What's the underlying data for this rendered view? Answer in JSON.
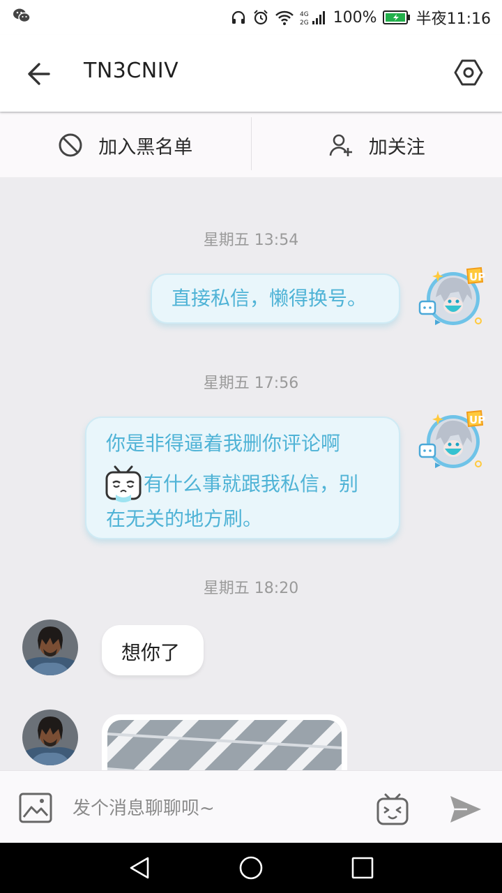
{
  "status_bar": {
    "battery_percent": "100%",
    "time": "半夜11:16",
    "network_label_top": "4G",
    "network_label_bottom": "2G",
    "icons": [
      "wechat-icon",
      "headphone-icon",
      "alarm-icon",
      "wifi-icon",
      "signal-icon",
      "battery-icon"
    ]
  },
  "header": {
    "title": "TN3CNIV",
    "back_icon": "arrow-left-icon",
    "settings_icon": "hexagon-settings-icon"
  },
  "actions": {
    "block_label": "加入黑名单",
    "follow_label": "加关注"
  },
  "messages": [
    {
      "timestamp": "星期五 13:54",
      "sender": "me",
      "text": "直接私信，懒得换号。"
    },
    {
      "timestamp": "星期五 17:56",
      "sender": "me",
      "line1": "你是非得逼着我删你评论啊",
      "line2": "有什么事就跟我私信，别",
      "line3": "在无关的地方刷。"
    },
    {
      "timestamp": "星期五 18:20",
      "sender": "other",
      "text": "想你了"
    },
    {
      "sender": "other",
      "type": "image"
    }
  ],
  "badges": {
    "up_badge": "UP"
  },
  "input": {
    "placeholder": "发个消息聊聊呗~"
  },
  "colors": {
    "outgoing_text": "#4fb3d6",
    "outgoing_bg": "#e9f6fb",
    "chat_bg": "#edecef",
    "battery_green": "#22b04b"
  }
}
